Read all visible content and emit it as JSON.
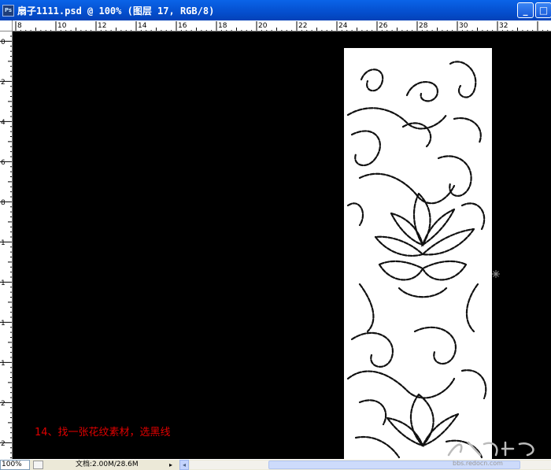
{
  "titlebar": {
    "app_icon": "photoshop-app-icon",
    "app_icon_text": "Ps",
    "document_title": "扇子1111.psd @ 100% (图层 17, RGB/8)",
    "minimize_icon": "minimize-icon",
    "maximize_icon": "maximize-icon"
  },
  "ruler_horizontal": {
    "labels": [
      "8",
      "10",
      "12",
      "14",
      "16",
      "18",
      "20",
      "22",
      "24",
      "26",
      "28",
      "30",
      "32"
    ]
  },
  "ruler_vertical": {
    "labels": [
      "0",
      "2",
      "4",
      "6",
      "8",
      "1",
      "1",
      "1",
      "1",
      "2",
      "2"
    ]
  },
  "canvas": {
    "background": "#000000",
    "caption": "14、找一张花纹素材，选黑线",
    "caption_color": "#e00000",
    "pattern_description": "floral-line-pattern-image",
    "cursor": "magic-wand-cursor-icon"
  },
  "statusbar": {
    "zoom": "100%",
    "doc_info": "文档:2.00M/28.6M",
    "menu_arrow": "▸",
    "scroll_left_arrow": "◂"
  },
  "watermark": {
    "text": "bbs.redocn.com"
  }
}
